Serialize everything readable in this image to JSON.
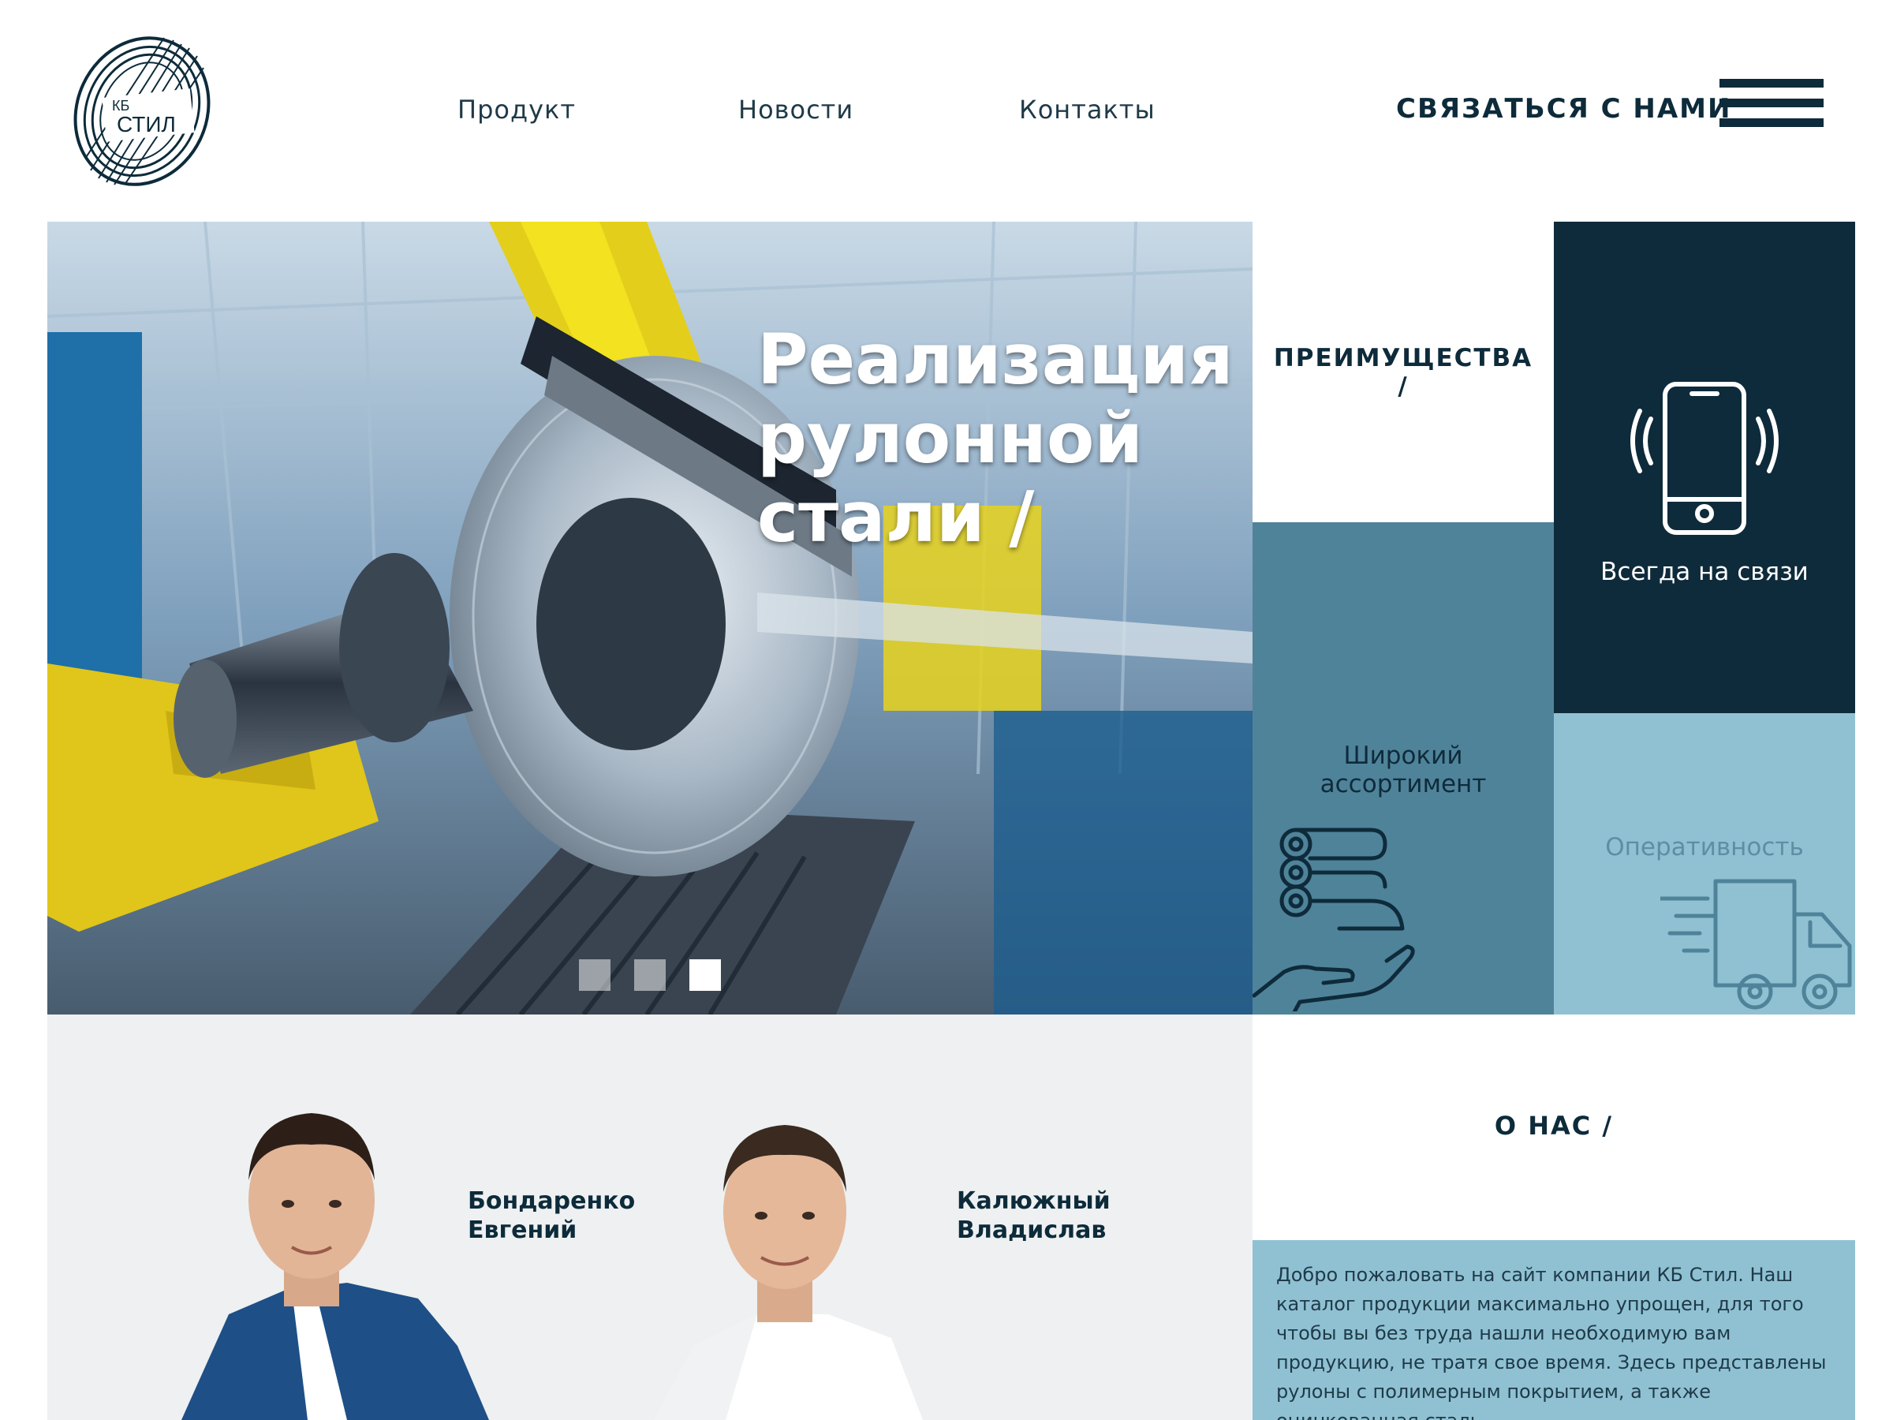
{
  "header": {
    "logo": {
      "line1": "КБ",
      "line2": "СТИЛ"
    },
    "nav": [
      "Продукт",
      "Новости",
      "Контакты"
    ],
    "cta": "СВЯЗАТЬСЯ С НАМИ",
    "menu_icon": "hamburger-icon"
  },
  "hero": {
    "title_lines": [
      "Реализация",
      "рулонной",
      "стали /"
    ],
    "slider": {
      "slide_count": 3,
      "active_slide": 3
    }
  },
  "advantages": {
    "title": "ПРЕИМУЩЕСТВА",
    "title_suffix": "/",
    "items": [
      {
        "label": "Всегда на связи",
        "icon": "phone-icon"
      },
      {
        "label_line1": "Широкий",
        "label_line2": "ассортимент",
        "icon": "steel-coils-hand-icon"
      },
      {
        "label": "Оперативность",
        "icon": "delivery-truck-icon"
      }
    ]
  },
  "team": {
    "people": [
      {
        "surname": "Бондаренко",
        "first_name": "Евгений"
      },
      {
        "surname": "Калюжный",
        "first_name": "Владислав"
      }
    ]
  },
  "about": {
    "title": "О НАС /",
    "text": "Добро пожаловать на сайт компании КБ Стил. Наш каталог продукции максимально упрощен, для того чтобы вы без труда нашли необходимую вам продукцию, не тратя свое время. Здесь представлены рулоны с полимерным покрытием, а также оцинкованная сталь."
  },
  "colors": {
    "navy": "#0e2b3b",
    "teal": "#4f8399",
    "light_blue": "#8fc1d3",
    "white": "#ffffff"
  }
}
